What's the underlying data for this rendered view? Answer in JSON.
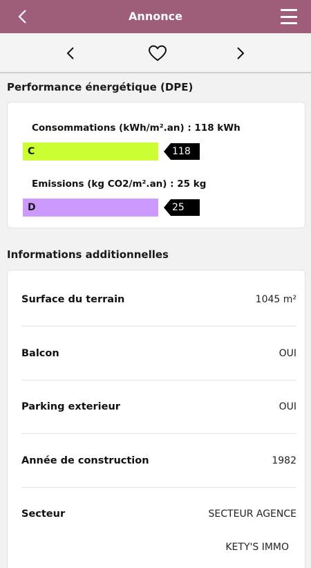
{
  "header": {
    "title": "Annonce",
    "back_icon": "chevron-left-icon",
    "menu_icon": "hamburger-menu-icon"
  },
  "navigation": {
    "prev_icon": "chevron-left-icon",
    "favorite_icon": "heart-outline-icon",
    "next_icon": "chevron-right-icon"
  },
  "dpe": {
    "title": "Performance énergétique (DPE)",
    "consumption": {
      "label": "Consommations (kWh/m².an) : 118 kWh",
      "class": "C",
      "value": "118",
      "color": "#ccff33"
    },
    "emissions": {
      "label": "Emissions (kg CO2/m².an) : 25 kg",
      "class": "D",
      "value": "25",
      "color": "#cc99ff"
    }
  },
  "info": {
    "title": "Informations additionnelles",
    "rows": [
      {
        "label": "Surface du terrain",
        "value": "1045 m²"
      },
      {
        "label": "Balcon",
        "value": "OUI"
      },
      {
        "label": "Parking exterieur",
        "value": "OUI"
      },
      {
        "label": "Année de construction",
        "value": "1982"
      },
      {
        "label": "Secteur",
        "value": "SECTEUR AGENCE"
      }
    ],
    "extra_value": "KETY'S IMMO"
  }
}
